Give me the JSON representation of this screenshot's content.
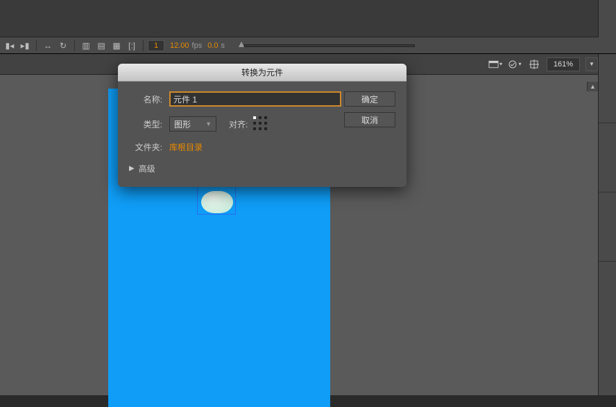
{
  "timeline": {
    "frame": "1",
    "fps": "12.00",
    "fps_unit": "fps",
    "secs": "0.0",
    "secs_unit": "s"
  },
  "options": {
    "zoom": "161%"
  },
  "dialog": {
    "title": "转换为元件",
    "name_label": "名称:",
    "name_value": "元件 1",
    "type_label": "类型:",
    "type_value": "图形",
    "align_label": "对齐:",
    "folder_label": "文件夹:",
    "folder_value": "库根目录",
    "advanced": "高级",
    "ok": "确定",
    "cancel": "取消"
  }
}
